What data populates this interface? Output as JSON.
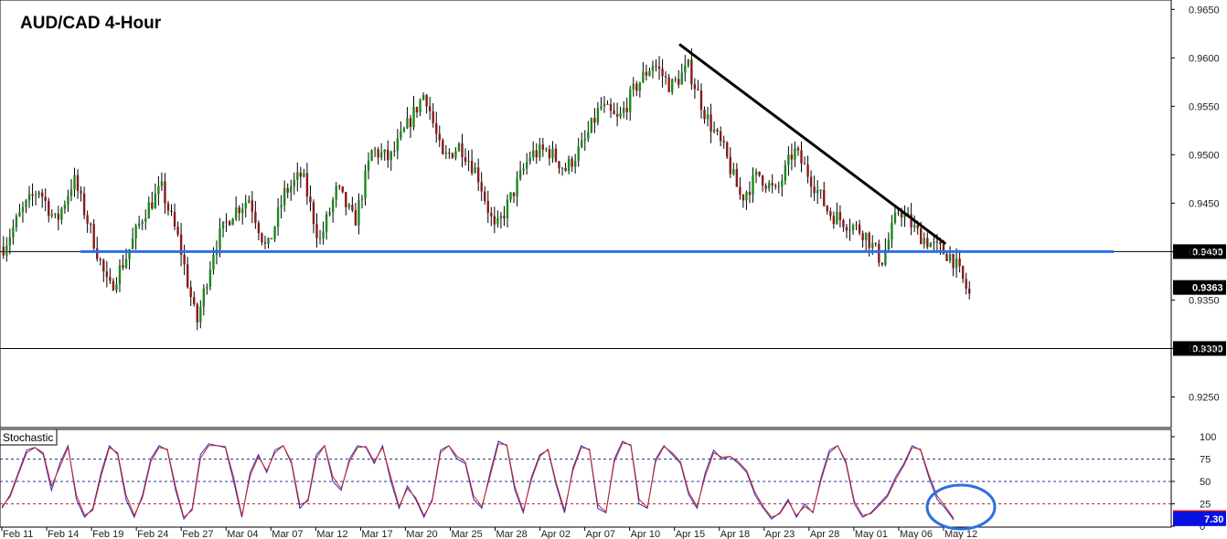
{
  "chart_data": [
    {
      "type": "candlestick",
      "title": "AUD/CAD 4-Hour",
      "x_labels": [
        "Feb 11",
        "Feb 14",
        "Feb 19",
        "Feb 24",
        "Feb 27",
        "Mar 04",
        "Mar 07",
        "Mar 12",
        "Mar 17",
        "Mar 20",
        "Mar 25",
        "Mar 28",
        "Apr 02",
        "Apr 07",
        "Apr 10",
        "Apr 15",
        "Apr 18",
        "Apr 23",
        "Apr 28",
        "May 01",
        "May 06",
        "May 12"
      ],
      "y_ticks": [
        "0.9650",
        "0.9600",
        "0.9550",
        "0.9500",
        "0.9450",
        "0.9400",
        "0.9350",
        "0.9300",
        "0.9250"
      ],
      "ylim": [
        0.9225,
        0.9655
      ],
      "trend_close": [
        [
          0,
          0.9405
        ],
        [
          1,
          0.944
        ],
        [
          2,
          0.9465
        ],
        [
          3,
          0.943
        ],
        [
          4,
          0.9475
        ],
        [
          5,
          0.942
        ],
        [
          6,
          0.936
        ],
        [
          7,
          0.9395
        ],
        [
          8,
          0.944
        ],
        [
          9,
          0.9465
        ],
        [
          10,
          0.941
        ],
        [
          11,
          0.9325
        ],
        [
          12,
          0.9405
        ],
        [
          13,
          0.944
        ],
        [
          14,
          0.9455
        ],
        [
          15,
          0.94
        ],
        [
          16,
          0.946
        ],
        [
          17,
          0.948
        ],
        [
          18,
          0.941
        ],
        [
          19,
          0.9465
        ],
        [
          20,
          0.943
        ],
        [
          21,
          0.9505
        ],
        [
          22,
          0.9495
        ],
        [
          23,
          0.953
        ],
        [
          24,
          0.9565
        ],
        [
          25,
          0.9495
        ],
        [
          26,
          0.951
        ],
        [
          27,
          0.948
        ],
        [
          28,
          0.942
        ],
        [
          29,
          0.946
        ],
        [
          30,
          0.95
        ],
        [
          31,
          0.9505
        ],
        [
          32,
          0.9485
        ],
        [
          33,
          0.951
        ],
        [
          34,
          0.955
        ],
        [
          35,
          0.9535
        ],
        [
          36,
          0.957
        ],
        [
          37,
          0.9595
        ],
        [
          38,
          0.957
        ],
        [
          39,
          0.959
        ],
        [
          40,
          0.954
        ],
        [
          41,
          0.9505
        ],
        [
          42,
          0.9455
        ],
        [
          43,
          0.948
        ],
        [
          44,
          0.946
        ],
        [
          45,
          0.9505
        ],
        [
          46,
          0.9475
        ],
        [
          47,
          0.944
        ],
        [
          48,
          0.943
        ],
        [
          49,
          0.942
        ],
        [
          50,
          0.939
        ],
        [
          51,
          0.9445
        ],
        [
          52,
          0.942
        ],
        [
          53,
          0.9405
        ],
        [
          54,
          0.9395
        ],
        [
          55,
          0.9355
        ]
      ],
      "trend_index_max": 55,
      "last_price": "0.9363",
      "horizontal_levels": [
        {
          "price": 0.94,
          "label": "0.9400"
        },
        {
          "price": 0.93,
          "label": "0.9300"
        }
      ],
      "support_line": {
        "price": 0.94,
        "color": "#2f6fe0"
      },
      "resistance_trendline": {
        "from": [
          0.5797,
          0.9614
        ],
        "to": [
          0.8373,
          0.9408
        ],
        "color": "#000000"
      },
      "colors": {
        "bull": "#1a8a1a",
        "bear": "#8a1a1a",
        "wick": "#000000",
        "price_tag_bg": "#000000"
      }
    },
    {
      "type": "line",
      "label": "Stochastic",
      "y_ticks": [
        "100",
        "75",
        "50",
        "25",
        "0"
      ],
      "ylim": [
        0,
        100
      ],
      "levels": [
        75,
        50,
        25
      ],
      "last_value": "7.30",
      "series": [
        {
          "color": "#2233cc",
          "values": [
            20,
            35,
            60,
            85,
            88,
            80,
            40,
            70,
            90,
            30,
            10,
            20,
            60,
            90,
            80,
            30,
            10,
            35,
            75,
            90,
            85,
            40,
            8,
            20,
            80,
            92,
            90,
            88,
            50,
            10,
            60,
            80,
            60,
            85,
            90,
            70,
            20,
            30,
            80,
            90,
            50,
            40,
            75,
            90,
            88,
            70,
            90,
            50,
            20,
            45,
            30,
            10,
            30,
            85,
            90,
            75,
            70,
            30,
            20,
            60,
            95,
            90,
            40,
            15,
            55,
            80,
            85,
            45,
            15,
            65,
            90,
            85,
            20,
            15,
            75,
            95,
            90,
            25,
            20,
            75,
            90,
            80,
            70,
            35,
            20,
            60,
            85,
            75,
            78,
            70,
            60,
            35,
            20,
            8,
            15,
            30,
            10,
            25,
            15,
            55,
            85,
            90,
            70,
            25,
            10,
            15,
            25,
            35,
            55,
            70,
            90,
            85,
            55,
            30,
            20,
            7
          ]
        },
        {
          "color": "#cc2222",
          "values": [
            22,
            33,
            58,
            82,
            88,
            82,
            45,
            66,
            88,
            35,
            12,
            18,
            56,
            88,
            82,
            35,
            12,
            32,
            72,
            88,
            86,
            44,
            10,
            18,
            76,
            90,
            90,
            89,
            55,
            12,
            56,
            78,
            62,
            82,
            90,
            72,
            24,
            28,
            76,
            90,
            55,
            42,
            72,
            88,
            89,
            72,
            88,
            55,
            22,
            42,
            32,
            12,
            28,
            82,
            90,
            78,
            72,
            34,
            22,
            56,
            92,
            91,
            44,
            17,
            52,
            78,
            86,
            48,
            18,
            62,
            88,
            86,
            24,
            16,
            72,
            93,
            91,
            30,
            21,
            72,
            89,
            82,
            72,
            38,
            22,
            56,
            82,
            77,
            78,
            72,
            62,
            38,
            22,
            10,
            14,
            28,
            12,
            22,
            16,
            52,
            82,
            90,
            72,
            28,
            12,
            14,
            23,
            33,
            52,
            68,
            88,
            86,
            58,
            34,
            22,
            9
          ]
        }
      ],
      "annotation": {
        "shape": "ellipse",
        "color": "#2f6fe0"
      },
      "colors": {
        "level_dash": "#2b3a8f",
        "level_25_dash": "#b03030",
        "last_tag_bg": "#0a10e0"
      }
    }
  ]
}
